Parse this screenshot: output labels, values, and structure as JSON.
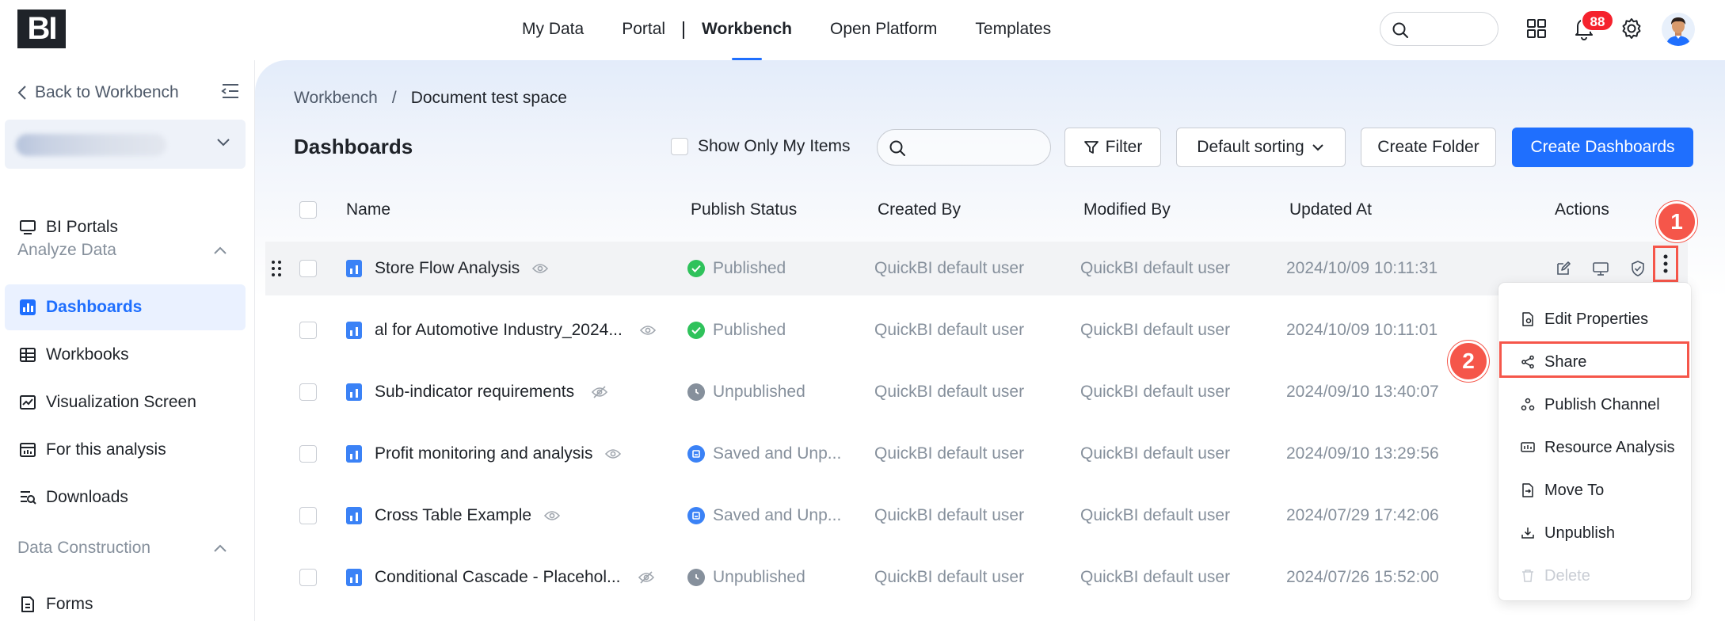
{
  "app": {
    "logo": "BI"
  },
  "top_nav": {
    "items": [
      "My Data",
      "Portal",
      "Workbench",
      "Open Platform",
      "Templates"
    ],
    "active": "Workbench"
  },
  "notifications": {
    "count": "88"
  },
  "sidebar": {
    "back_label": "Back to Workbench",
    "items": [
      {
        "label": "BI Portals",
        "icon": "monitor-icon"
      },
      {
        "label": "Dashboards",
        "icon": "bar-chart-icon",
        "active": true
      },
      {
        "label": "Workbooks",
        "icon": "table-icon"
      },
      {
        "label": "Visualization Screen",
        "icon": "line-chart-icon"
      },
      {
        "label": "For this analysis",
        "icon": "analysis-icon"
      },
      {
        "label": "Downloads",
        "icon": "download-list-icon"
      },
      {
        "label": "Forms",
        "icon": "form-icon"
      }
    ],
    "groups": {
      "analyze": "Analyze Data",
      "construction": "Data Construction"
    }
  },
  "breadcrumb": {
    "root": "Workbench",
    "separator": "/",
    "current": "Document test space"
  },
  "page": {
    "title": "Dashboards"
  },
  "toolbar": {
    "only_mine": "Show Only My Items",
    "filter": "Filter",
    "sort": "Default sorting",
    "create_folder": "Create Folder",
    "create_dashboard": "Create Dashboards"
  },
  "table": {
    "headers": {
      "name": "Name",
      "status": "Publish Status",
      "created_by": "Created By",
      "modified_by": "Modified By",
      "updated_at": "Updated At",
      "actions": "Actions"
    },
    "rows": [
      {
        "name": "Store Flow Analysis",
        "status": "Published",
        "created_by": "QuickBI default user",
        "modified_by": "QuickBI default user",
        "updated_at": "2024/10/09 10:11:31"
      },
      {
        "name": "al for Automotive Industry_2024...",
        "status": "Published",
        "created_by": "QuickBI default user",
        "modified_by": "QuickBI default user",
        "updated_at": "2024/10/09 10:11:01"
      },
      {
        "name": "Sub-indicator requirements",
        "status": "Unpublished",
        "created_by": "QuickBI default user",
        "modified_by": "QuickBI default user",
        "updated_at": "2024/09/10 13:40:07"
      },
      {
        "name": "Profit monitoring and analysis",
        "status": "Saved and Unp...",
        "created_by": "QuickBI default user",
        "modified_by": "QuickBI default user",
        "updated_at": "2024/09/10 13:29:56"
      },
      {
        "name": "Cross Table Example",
        "status": "Saved and Unp...",
        "created_by": "QuickBI default user",
        "modified_by": "QuickBI default user",
        "updated_at": "2024/07/29 17:42:06"
      },
      {
        "name": "Conditional Cascade - Placehol...",
        "status": "Unpublished",
        "created_by": "QuickBI default user",
        "modified_by": "QuickBI default user",
        "updated_at": "2024/07/26 15:52:00"
      }
    ]
  },
  "more_menu": {
    "items": [
      "Edit Properties",
      "Share",
      "Publish Channel",
      "Resource Analysis",
      "Move To",
      "Unpublish",
      "Delete"
    ]
  },
  "callouts": {
    "first": "1",
    "second": "2"
  },
  "colors": {
    "primary": "#1f6ffe",
    "published": "#2fc25b",
    "unpublished": "#86909c",
    "saved": "#3b82f6",
    "annotation": "#f5564a"
  }
}
